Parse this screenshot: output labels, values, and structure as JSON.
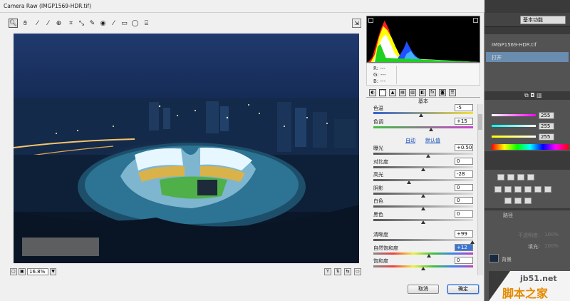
{
  "dialog": {
    "title": "Camera Raw (IMGP1569-HDR.tif)",
    "zoom": "16.8%",
    "cancel_label": "取消",
    "ok_label": "确定"
  },
  "readout": {
    "r_label": "R:",
    "g_label": "G:",
    "b_label": "B:",
    "r_value": "---",
    "g_value": "---",
    "b_value": "---"
  },
  "panel": {
    "title": "基本",
    "auto_link": "自动",
    "default_link": "默认值",
    "temp_label": "色温",
    "temp_value": "-5",
    "tint_label": "色调",
    "tint_value": "+15",
    "rows": [
      {
        "label": "曝光",
        "value": "+0.50",
        "pos": 0.55
      },
      {
        "label": "对比度",
        "value": "0",
        "pos": 0.5
      },
      {
        "label": "高光",
        "value": "-28",
        "pos": 0.36
      },
      {
        "label": "阴影",
        "value": "0",
        "pos": 0.5
      },
      {
        "label": "白色",
        "value": "0",
        "pos": 0.5
      },
      {
        "label": "黑色",
        "value": "0",
        "pos": 0.5
      }
    ],
    "presence": [
      {
        "label": "清晰度",
        "value": "+99",
        "pos": 0.99
      },
      {
        "label": "自然饱和度",
        "value": "+12",
        "pos": 0.56,
        "highlight": true
      },
      {
        "label": "饱和度",
        "value": "0",
        "pos": 0.5
      }
    ],
    "temp_pos": 0.48,
    "tint_pos": 0.58
  },
  "photoshop": {
    "workspace": "基本功能",
    "history_file": "IMGP1569-HDR.tif",
    "history_open": "打开",
    "color_values": [
      "255",
      "255",
      "255"
    ],
    "opacity_label": "不透明度:",
    "opacity_value": "100%",
    "fill_label": "填充:",
    "fill_value": "100%",
    "layer_name": "背景",
    "layers_tab": "路径"
  },
  "watermark": {
    "url": "jb51.net",
    "text": "脚本之家"
  },
  "colors": {
    "accent": "#3875d7",
    "link": "#1c4fb8"
  }
}
